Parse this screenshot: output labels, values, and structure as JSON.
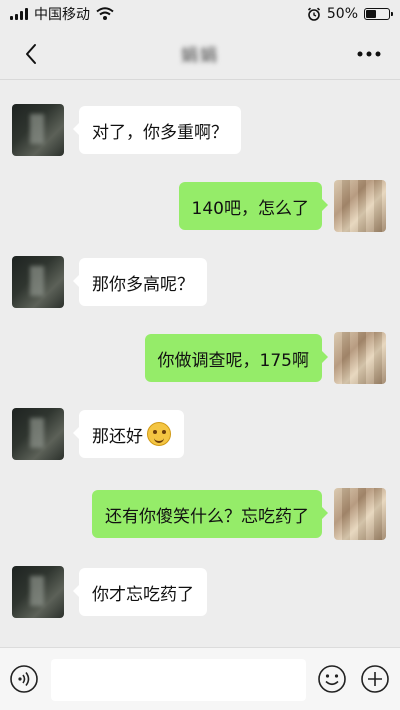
{
  "status_bar": {
    "carrier": "中国移动",
    "battery_percent": "50%",
    "battery_level": 0.5
  },
  "header": {
    "title": "娟娟",
    "back_icon": "chevron-left-icon",
    "more_icon": "ellipsis-icon"
  },
  "messages": [
    {
      "from": "peer",
      "text": "对了，你多重啊？"
    },
    {
      "from": "self",
      "text": "140吧，怎么了"
    },
    {
      "from": "peer",
      "text": "那你多高呢？"
    },
    {
      "from": "self",
      "text": "你做调查呢，175啊"
    },
    {
      "from": "peer",
      "text": "那还好",
      "emoji": "thinking-emoji"
    },
    {
      "from": "self",
      "text": "还有你傻笑什么？忘吃药了"
    },
    {
      "from": "peer",
      "text": "你才忘吃药了"
    }
  ],
  "input_bar": {
    "value": "",
    "voice_icon": "voice-icon",
    "emoji_icon": "emoji-icon",
    "plus_icon": "plus-icon"
  },
  "colors": {
    "self_bubble": "#95ec69",
    "peer_bubble": "#ffffff",
    "background": "#ededed"
  }
}
